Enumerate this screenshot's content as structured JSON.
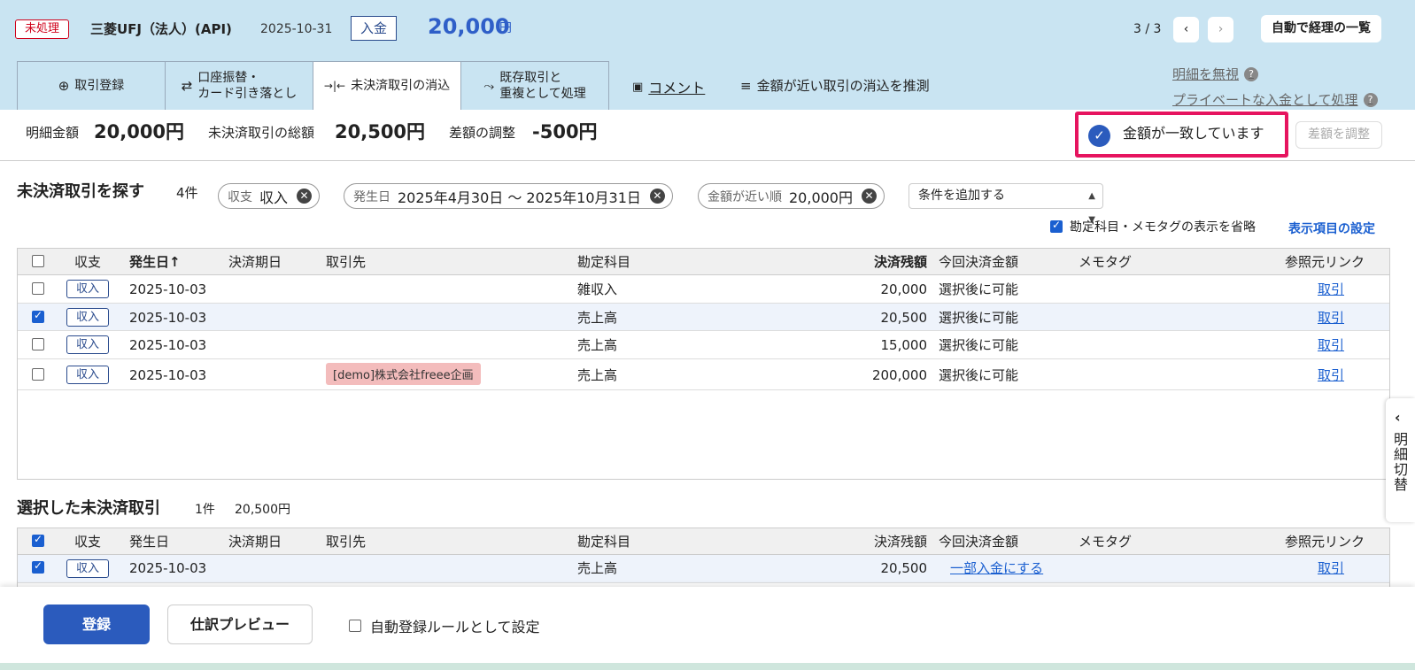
{
  "header": {
    "status": "未処理",
    "bank": "三菱UFJ（法人）(API)",
    "date": "2025-10-31",
    "type": "入金",
    "amount": "20,000",
    "unit": "円",
    "pager": "3 / 3",
    "prev_icon": "‹",
    "next_icon": "›",
    "auto_list": "自動で経理の一覧"
  },
  "tabs": [
    {
      "label": "取引登録",
      "icon": "⊕"
    },
    {
      "label": "口座振替・\nカード引き落とし",
      "icon": "⇄"
    },
    {
      "label": "未決済取引の消込",
      "icon": "→|←"
    },
    {
      "label": "既存取引と\n重複として処理",
      "icon": "⤳"
    }
  ],
  "links": {
    "comment": "コメント",
    "suggest": "金額が近い取引の消込を推測",
    "ignore": "明細を無視",
    "private": "プライベートな入金として処理",
    "help": "?"
  },
  "summary": {
    "detail_label": "明細金額",
    "detail_value": "20,000円",
    "total_label": "未決済取引の総額",
    "total_value": "20,500円",
    "diff_label": "差額の調整",
    "diff_value": "-500円",
    "match_text": "金額が一致しています",
    "adjust_button": "差額を調整"
  },
  "search": {
    "title": "未決済取引を探す",
    "count": "4件",
    "chips": [
      {
        "label": "収支",
        "value": "収入"
      },
      {
        "label": "発生日",
        "value": "2025年4月30日 〜 2025年10月31日"
      },
      {
        "label": "金額が近い順",
        "value": "20,000円"
      }
    ],
    "add_condition": "条件を追加する",
    "omit_option": "勘定科目・メモタグの表示を省略",
    "display_settings": "表示項目の設定"
  },
  "columns": [
    "収支",
    "発生日",
    "決済期日",
    "取引先",
    "勘定科目",
    "決済残額",
    "今回決済金額",
    "メモタグ",
    "参照元リンク"
  ],
  "sort_arrow": "↑",
  "rows": [
    {
      "type": "収入",
      "date": "2025-10-03",
      "due": "",
      "partner": "",
      "account": "雑収入",
      "balance": "20,000",
      "pay": "選択後に可能",
      "memo": "",
      "link": "取引",
      "checked": false
    },
    {
      "type": "収入",
      "date": "2025-10-03",
      "due": "",
      "partner": "",
      "account": "売上高",
      "balance": "20,500",
      "pay": "選択後に可能",
      "memo": "",
      "link": "取引",
      "checked": true
    },
    {
      "type": "収入",
      "date": "2025-10-03",
      "due": "",
      "partner": "",
      "account": "売上高",
      "balance": "15,000",
      "pay": "選択後に可能",
      "memo": "",
      "link": "取引",
      "checked": false
    },
    {
      "type": "収入",
      "date": "2025-10-03",
      "due": "",
      "partner": "[demo]株式会社freee企画",
      "account": "売上高",
      "balance": "200,000",
      "pay": "選択後に可能",
      "memo": "",
      "link": "取引",
      "checked": false
    }
  ],
  "selected": {
    "title": "選択した未決済取引",
    "count": "1件",
    "total": "20,500円",
    "row": {
      "type": "収入",
      "date": "2025-10-03",
      "account": "売上高",
      "balance": "20,500",
      "partial": "一部入金にする",
      "link": "取引"
    }
  },
  "footer": {
    "register": "登録",
    "preview": "仕訳プレビュー",
    "auto_rule": "自動登録ルールとして設定"
  },
  "side_tab": {
    "label": "明細切替",
    "chevron": "‹"
  }
}
